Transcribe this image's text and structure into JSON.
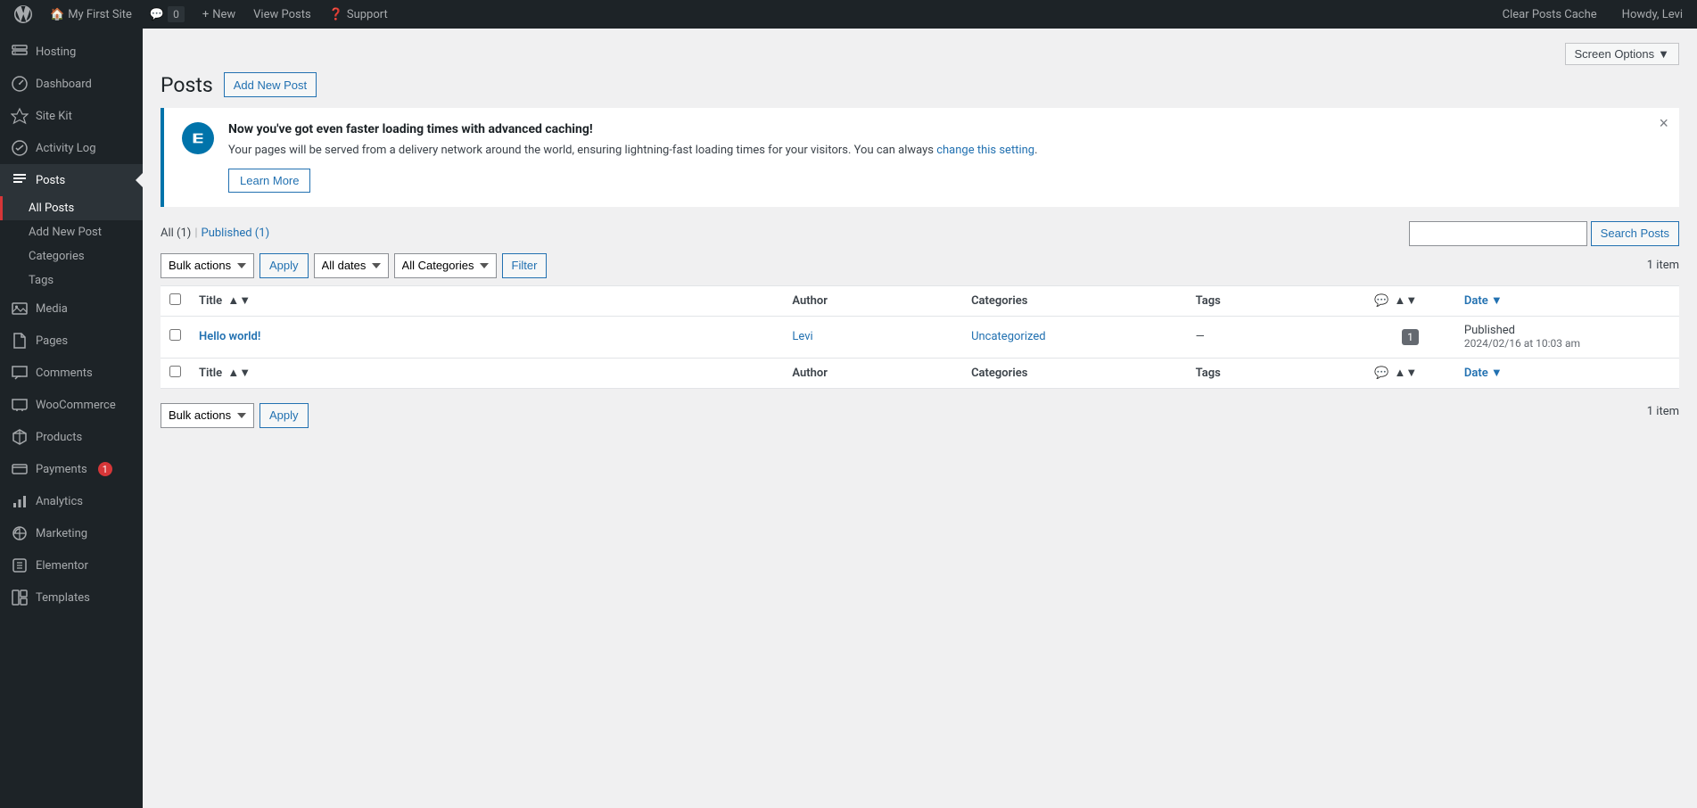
{
  "adminbar": {
    "logo_label": "WordPress",
    "site_name": "My First Site",
    "comments_count": "0",
    "new_label": "New",
    "view_posts_label": "View Posts",
    "support_label": "Support",
    "clear_cache_label": "Clear Posts Cache",
    "howdy_label": "Howdy, Levi",
    "screen_options_label": "Screen Options"
  },
  "sidebar": {
    "items": [
      {
        "id": "hosting",
        "label": "Hosting",
        "icon": "server"
      },
      {
        "id": "dashboard",
        "label": "Dashboard",
        "icon": "dashboard"
      },
      {
        "id": "sitekit",
        "label": "Site Kit",
        "icon": "sitekit"
      },
      {
        "id": "activity-log",
        "label": "Activity Log",
        "icon": "activity"
      },
      {
        "id": "posts",
        "label": "Posts",
        "icon": "posts",
        "active": true
      }
    ],
    "submenu": [
      {
        "id": "all-posts",
        "label": "All Posts",
        "active": true
      },
      {
        "id": "add-new-post",
        "label": "Add New Post"
      },
      {
        "id": "categories",
        "label": "Categories"
      },
      {
        "id": "tags",
        "label": "Tags"
      }
    ],
    "items2": [
      {
        "id": "media",
        "label": "Media",
        "icon": "media"
      },
      {
        "id": "pages",
        "label": "Pages",
        "icon": "pages"
      },
      {
        "id": "comments",
        "label": "Comments",
        "icon": "comments"
      },
      {
        "id": "woocommerce",
        "label": "WooCommerce",
        "icon": "woo"
      },
      {
        "id": "products",
        "label": "Products",
        "icon": "products"
      },
      {
        "id": "payments",
        "label": "Payments",
        "icon": "payments",
        "badge": "1"
      },
      {
        "id": "analytics",
        "label": "Analytics",
        "icon": "analytics"
      },
      {
        "id": "marketing",
        "label": "Marketing",
        "icon": "marketing"
      },
      {
        "id": "elementor",
        "label": "Elementor",
        "icon": "elementor"
      },
      {
        "id": "templates",
        "label": "Templates",
        "icon": "templates"
      }
    ]
  },
  "page": {
    "title": "Posts",
    "add_new_btn": "Add New Post"
  },
  "notice": {
    "title": "Now you've got even faster loading times with advanced caching!",
    "text": "Your pages will be served from a delivery network around the world, ensuring lightning-fast loading times for your visitors. You can always ",
    "link_text": "change this setting",
    "text_after": ".",
    "learn_more": "Learn More"
  },
  "filter_links": [
    {
      "id": "all",
      "label": "All",
      "count": "1",
      "active": true
    },
    {
      "id": "published",
      "label": "Published",
      "count": "1",
      "active": false
    }
  ],
  "table": {
    "item_count_top": "1 item",
    "item_count_bottom": "1 item",
    "bulk_actions_label": "Bulk actions",
    "all_dates_label": "All dates",
    "all_categories_label": "All Categories",
    "apply_label_top": "Apply",
    "filter_label": "Filter",
    "apply_label_bottom": "Apply",
    "search_placeholder": "",
    "search_btn": "Search Posts",
    "columns": [
      {
        "id": "title",
        "label": "Title",
        "sortable": true
      },
      {
        "id": "author",
        "label": "Author"
      },
      {
        "id": "categories",
        "label": "Categories"
      },
      {
        "id": "tags",
        "label": "Tags"
      },
      {
        "id": "comments",
        "label": "💬",
        "sortable": true
      },
      {
        "id": "date",
        "label": "Date",
        "sortable": true,
        "sorted": "desc"
      }
    ],
    "rows": [
      {
        "id": "1",
        "title": "Hello world!",
        "title_link": "#",
        "author": "Levi",
        "categories": "Uncategorized",
        "tags": "—",
        "comments": "1",
        "status": "Published",
        "date": "2024/02/16 at 10:03 am"
      }
    ]
  }
}
